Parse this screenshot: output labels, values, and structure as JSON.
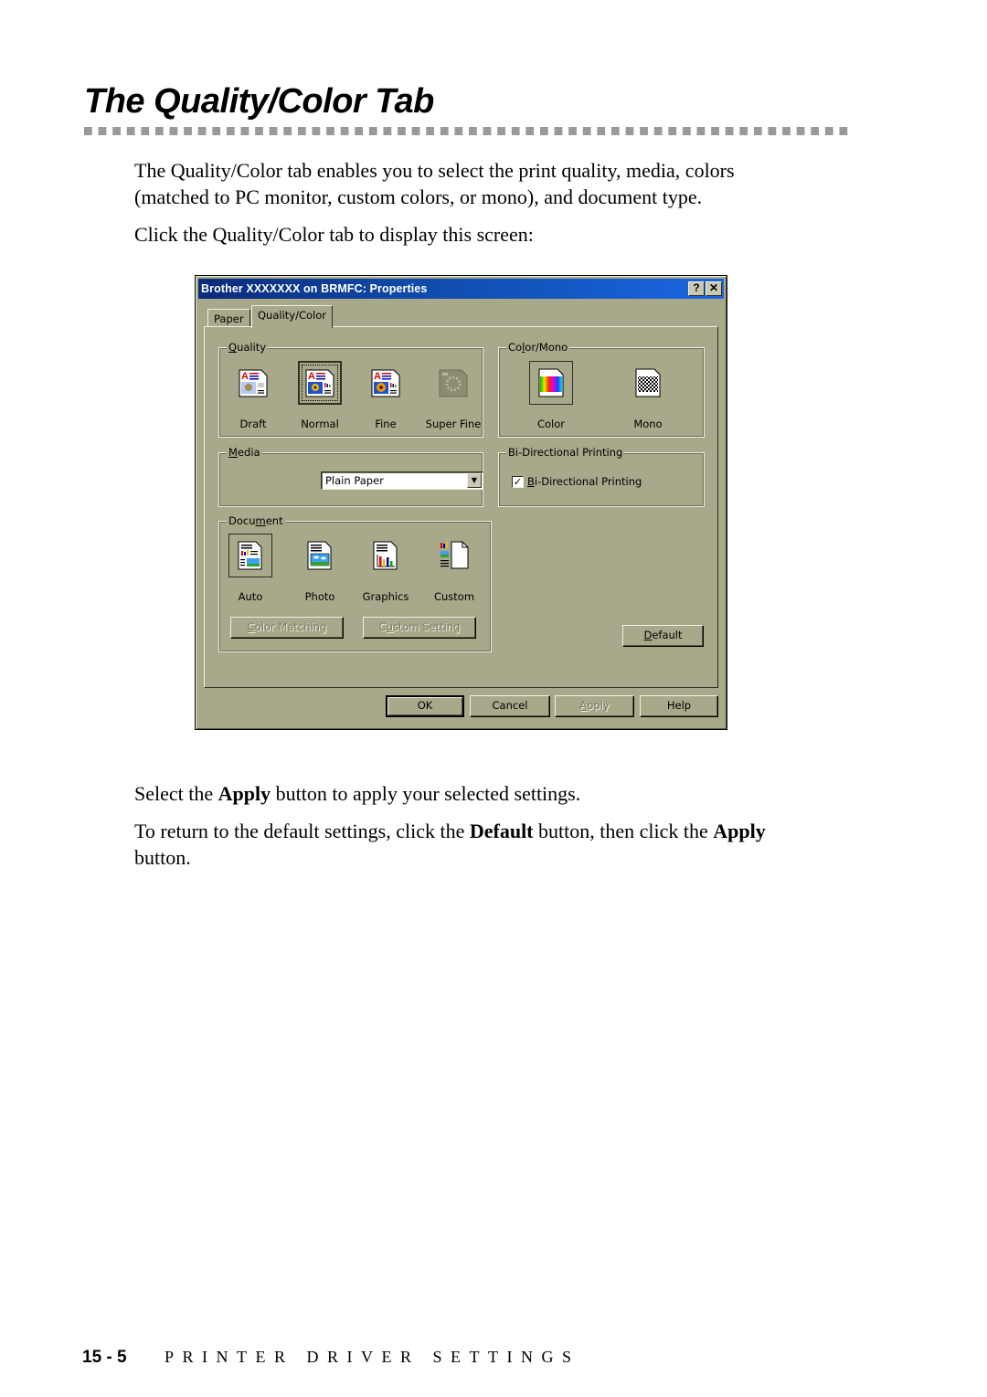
{
  "page": {
    "heading": "The Quality/Color Tab",
    "intro_line1": "The Quality/Color tab enables you to select the print quality, media, colors",
    "intro_line2": "(matched to PC monitor, custom colors, or mono), and document type.",
    "instruction": "Click the Quality/Color tab to display this screen:",
    "apply_text": {
      "pre": "Select the ",
      "bold": "Apply",
      "post": " button to apply your selected settings."
    },
    "default_text": {
      "pre": "To return to the default settings, click the ",
      "bold1": "Default",
      "mid": " button, then click the ",
      "bold2": "Apply",
      "line2": "button."
    },
    "footer": {
      "page_number": "15 - 5",
      "section": "PRINTER DRIVER SETTINGS"
    }
  },
  "dialog": {
    "title": "Brother XXXXXXX  on BRMFC: Properties",
    "help_button": "?",
    "close_button": "✕",
    "tabs": [
      {
        "label": "Paper",
        "active": false
      },
      {
        "label": "Quality/Color",
        "active": true
      }
    ],
    "quality": {
      "label_u": "Q",
      "label_rest": "uality",
      "options": [
        {
          "label": "Draft",
          "icon": "draft-quality-icon",
          "selected": false,
          "enabled": true
        },
        {
          "label": "Normal",
          "icon": "normal-quality-icon",
          "selected": true,
          "enabled": true
        },
        {
          "label": "Fine",
          "icon": "fine-quality-icon",
          "selected": false,
          "enabled": true
        },
        {
          "label": "Super Fine",
          "icon": "super-fine-quality-icon",
          "selected": false,
          "enabled": false
        }
      ]
    },
    "color_mono": {
      "label_pre": "Co",
      "label_u": "l",
      "label_rest": "or/Mono",
      "options": [
        {
          "label": "Color",
          "icon": "color-rainbow-icon",
          "selected": true
        },
        {
          "label": "Mono",
          "icon": "mono-checker-icon",
          "selected": false
        }
      ]
    },
    "media": {
      "label_u": "M",
      "label_rest": "edia",
      "selected_value": "Plain Paper"
    },
    "bidirectional": {
      "group_label": "Bi-Directional Printing",
      "checkbox_u": "B",
      "checkbox_rest": "i-Directional Printing",
      "checked": true
    },
    "document": {
      "label_pre": "Docu",
      "label_u": "m",
      "label_rest": "ent",
      "options": [
        {
          "label": "Auto",
          "icon": "auto-document-icon",
          "selected": true
        },
        {
          "label": "Photo",
          "icon": "photo-document-icon",
          "selected": false
        },
        {
          "label": "Graphics",
          "icon": "graphics-document-icon",
          "selected": false
        },
        {
          "label": "Custom",
          "icon": "custom-document-icon",
          "selected": false
        }
      ],
      "color_matching_u": "C",
      "color_matching_rest": "olor Matching",
      "custom_setting_pre": "C",
      "custom_setting_u": "u",
      "custom_setting_rest": "stom Setting"
    },
    "default_button_u": "D",
    "default_button_rest": "efault",
    "buttons": {
      "ok": "OK",
      "cancel": "Cancel",
      "apply_u": "A",
      "apply_rest": "pply",
      "help": "Help"
    },
    "colors": {
      "face": "#a8a88a",
      "title_start": "#0a2a7a",
      "title_end": "#1a66e0"
    }
  }
}
